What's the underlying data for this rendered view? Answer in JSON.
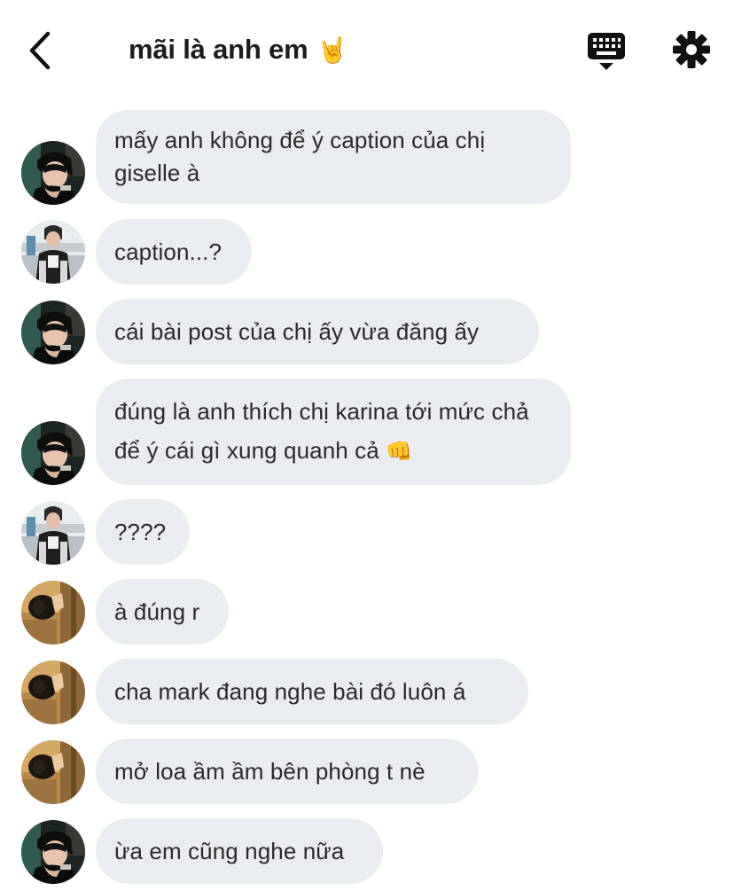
{
  "header": {
    "title": "mãi là anh em",
    "title_emoji": "🤘"
  },
  "messages": [
    {
      "text": "mấy anh không để ý caption của chị giselle à",
      "avatar": "avatar-user-a"
    },
    {
      "text": "caption...?",
      "avatar": "avatar-user-b"
    },
    {
      "text": "cái bài post của chị ấy vừa đăng ấy",
      "avatar": "avatar-user-a"
    },
    {
      "text": "đúng là anh thích chị karina tới mức chả để ý cái gì xung quanh cả",
      "emoji": "👊",
      "avatar": "avatar-user-a"
    },
    {
      "text": "????",
      "avatar": "avatar-user-b"
    },
    {
      "text": "à đúng r",
      "avatar": "avatar-user-c"
    },
    {
      "text": "cha mark đang nghe bài đó luôn á",
      "avatar": "avatar-user-c"
    },
    {
      "text": "mở loa ầm ầm bên phòng t nè",
      "avatar": "avatar-user-c"
    },
    {
      "text": "ừa em cũng nghe nữa",
      "avatar": "avatar-user-a"
    }
  ],
  "icons": {
    "back": "chevron-left-icon",
    "keyboard": "keyboard-icon",
    "settings": "gear-icon"
  },
  "colors": {
    "bubble": "#e9ecf0",
    "text": "#1c1c1e",
    "background": "#ffffff"
  }
}
